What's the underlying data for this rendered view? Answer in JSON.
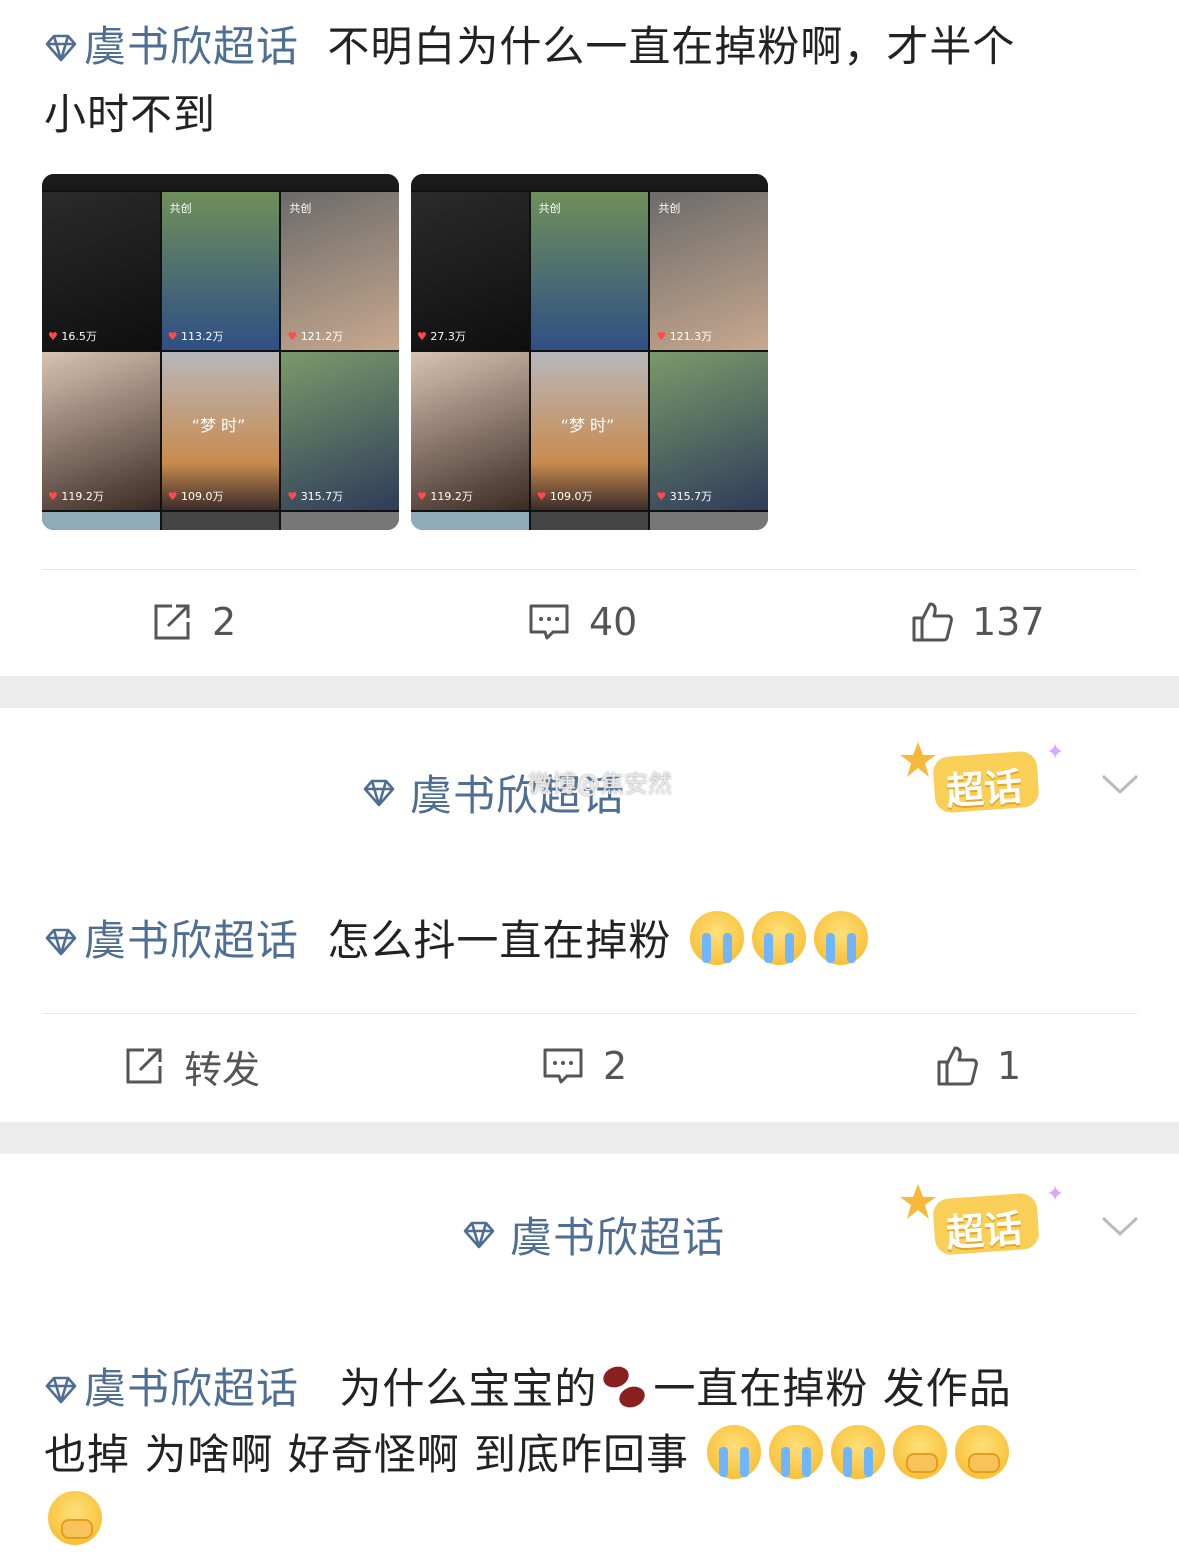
{
  "post1": {
    "topic": "虞书欣超话",
    "text_line1": "不明白为什么一直在掉粉啊，才半个",
    "text_line2": "小时不到",
    "images": [
      {
        "cells": [
          {
            "tag": "",
            "likes": "16.5万"
          },
          {
            "tag": "共创",
            "likes": "113.2万"
          },
          {
            "tag": "共创",
            "likes": "121.2万"
          },
          {
            "tag": "",
            "likes": "119.2万"
          },
          {
            "tag": "",
            "likes": "109.0万",
            "caption": "“梦 时”"
          },
          {
            "tag": "",
            "likes": "315.7万"
          }
        ]
      },
      {
        "cells": [
          {
            "tag": "",
            "likes": "27.3万"
          },
          {
            "tag": "共创",
            "likes": ""
          },
          {
            "tag": "共创",
            "likes": "121.3万"
          },
          {
            "tag": "",
            "likes": "119.2万"
          },
          {
            "tag": "",
            "likes": "109.0万",
            "caption": "“梦 时”"
          },
          {
            "tag": "",
            "likes": "315.7万"
          }
        ]
      }
    ],
    "actions": {
      "repost": "2",
      "comment": "40",
      "like": "137"
    }
  },
  "post2": {
    "header_topic": "虞书欣超话",
    "badge": "超话",
    "watermark": "微博@焦安然",
    "topic": "虞书欣超话",
    "text": "怎么抖一直在掉粉",
    "actions": {
      "repost": "转发",
      "comment": "2",
      "like": "1"
    }
  },
  "post3": {
    "header_topic": "虞书欣超话",
    "badge": "超话",
    "topic": "虞书欣超话",
    "text_a": "为什么宝宝的",
    "text_b": "一直在掉粉 发作品",
    "text_line2": "也掉 为啥啊 好奇怪啊 到底咋回事"
  },
  "icons": [
    "topic-diamond-icon",
    "repost-icon",
    "comment-icon",
    "like-icon",
    "chevron-down-icon",
    "crying-emoji",
    "covering-mouth-emoji",
    "bean-emoji"
  ],
  "colors": {
    "topic": "#4e6e93",
    "divider": "#e6e6e6",
    "gap": "#ececec",
    "badge": "#f7c948",
    "heart": "#ff4a4a"
  }
}
